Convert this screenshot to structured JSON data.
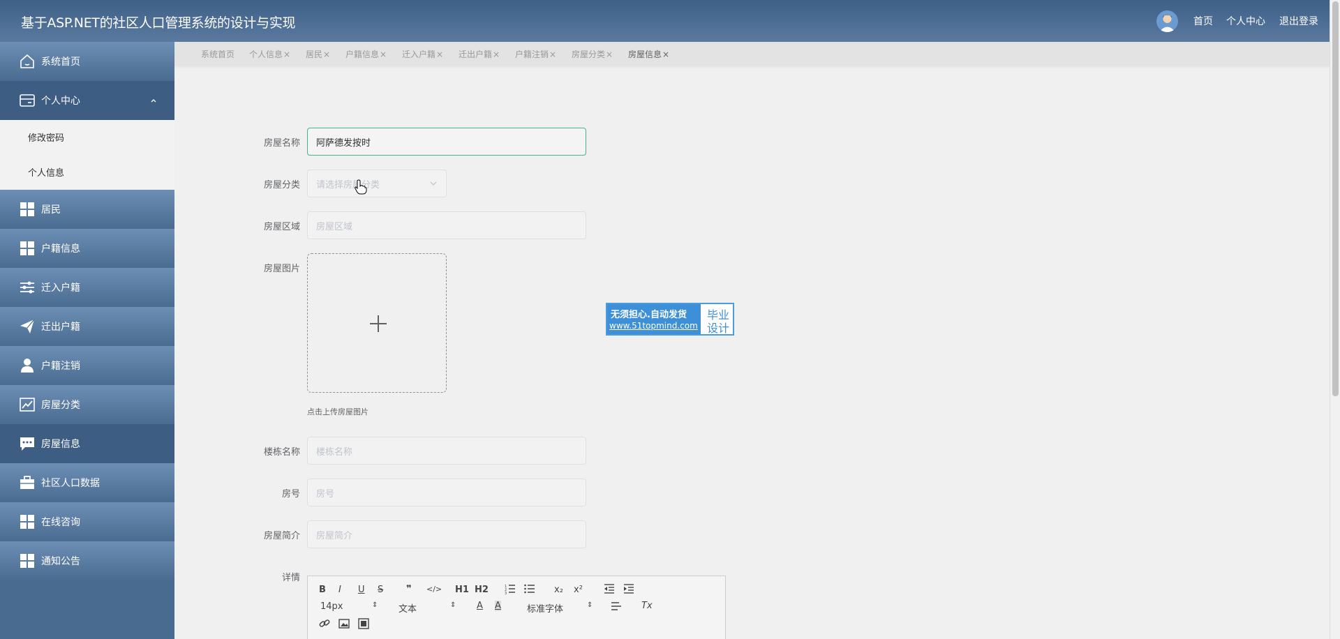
{
  "header": {
    "title": "基于ASP.NET的社区人口管理系统的设计与实现",
    "nav": [
      "首页",
      "个人中心",
      "退出登录"
    ]
  },
  "sidebar": {
    "items": [
      {
        "label": "系统首页",
        "icon": "home-icon"
      },
      {
        "label": "个人中心",
        "icon": "wallet-icon"
      },
      {
        "label": "居民",
        "icon": "grid-icon"
      },
      {
        "label": "户籍信息",
        "icon": "grid-icon"
      },
      {
        "label": "迁入户籍",
        "icon": "sliders-icon"
      },
      {
        "label": "迁出户籍",
        "icon": "send-icon"
      },
      {
        "label": "户籍注销",
        "icon": "user-icon"
      },
      {
        "label": "房屋分类",
        "icon": "chart-icon"
      },
      {
        "label": "房屋信息",
        "icon": "message-icon"
      },
      {
        "label": "社区人口数据",
        "icon": "briefcase-icon"
      },
      {
        "label": "在线咨询",
        "icon": "grid-icon"
      },
      {
        "label": "通知公告",
        "icon": "grid-icon"
      }
    ],
    "submenu": [
      "修改密码",
      "个人信息"
    ]
  },
  "tabs": [
    {
      "label": "系统首页",
      "closable": false
    },
    {
      "label": "个人信息",
      "closable": true
    },
    {
      "label": "居民",
      "closable": true
    },
    {
      "label": "户籍信息",
      "closable": true
    },
    {
      "label": "迁入户籍",
      "closable": true
    },
    {
      "label": "迁出户籍",
      "closable": true
    },
    {
      "label": "户籍注销",
      "closable": true
    },
    {
      "label": "房屋分类",
      "closable": true
    },
    {
      "label": "房屋信息",
      "closable": true
    }
  ],
  "tab_close": "×",
  "form": {
    "name_label": "房屋名称",
    "name_value": "阿萨德发按时",
    "category_label": "房屋分类",
    "category_placeholder": "请选择房屋分类",
    "area_label": "房屋区域",
    "area_placeholder": "房屋区域",
    "image_label": "房屋图片",
    "image_tip": "点击上传房屋图片",
    "building_label": "楼栋名称",
    "building_placeholder": "楼栋名称",
    "room_label": "房号",
    "room_placeholder": "房号",
    "intro_label": "房屋简介",
    "intro_placeholder": "房屋简介",
    "detail_label": "详情"
  },
  "editor": {
    "font_size": "14px",
    "block_type": "文本",
    "font_family": "标准字体",
    "buttons": [
      "B",
      "I",
      "U",
      "S",
      "❞",
      "</>",
      "H1",
      "H2",
      "x₂",
      "x²",
      "Tx"
    ]
  },
  "watermark": {
    "line1": "无须担心.自动发货",
    "line2": "www.51topmind.com",
    "right1": "毕业",
    "right2": "设计"
  },
  "colors": {
    "header": "#4a6b90",
    "sidebar": "#4a6b90",
    "focus_border": "#41b883",
    "watermark_blue": "#3d8fd8"
  }
}
